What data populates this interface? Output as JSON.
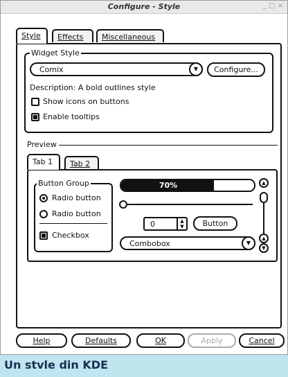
{
  "window": {
    "title": "Configure - Style",
    "controls": "_ □ ×"
  },
  "tabs": [
    {
      "label": "Style",
      "active": true
    },
    {
      "label": "Effects",
      "active": false
    },
    {
      "label": "Miscellaneous",
      "active": false
    }
  ],
  "widget_style": {
    "legend": "Widget Style",
    "selected": "Comix",
    "configure_label": "Configure...",
    "description": "Description: A bold outlines style",
    "show_icons_label": "Show icons on buttons",
    "show_icons_checked": false,
    "enable_tooltips_label": "Enable tooltips",
    "enable_tooltips_checked": true
  },
  "preview": {
    "label": "Preview",
    "tabs": [
      {
        "label": "Tab 1",
        "active": true
      },
      {
        "label": "Tab 2",
        "active": false
      }
    ],
    "button_group": {
      "legend": "Button Group",
      "radio1": "Radio button",
      "radio2": "Radio button",
      "checkbox": "Checkbox"
    },
    "progress_text": "70%",
    "progress_value": 70,
    "spin_value": "0",
    "button_label": "Button",
    "combobox_label": "Combobox"
  },
  "footer": {
    "help": "Help",
    "defaults": "Defaults",
    "ok": "OK",
    "apply": "Apply",
    "cancel": "Cancel"
  },
  "caption": "Un stvle din KDE"
}
